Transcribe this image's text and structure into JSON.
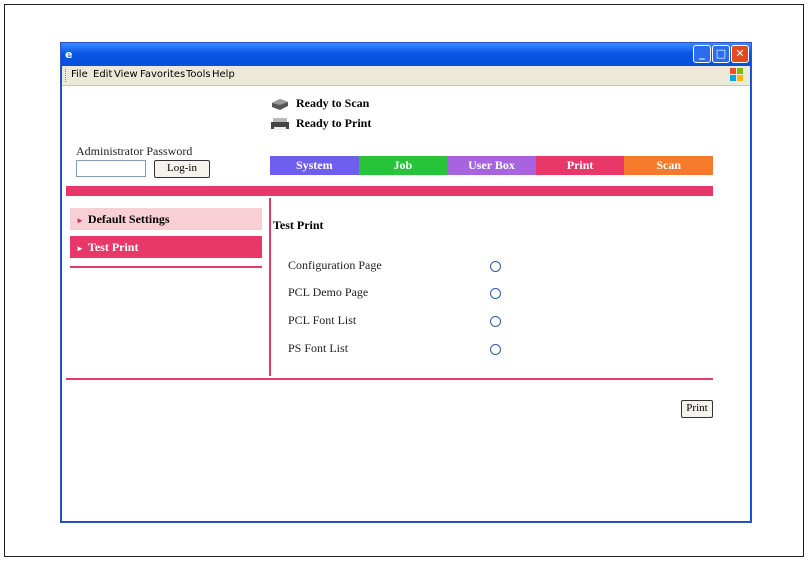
{
  "menu": [
    "File",
    "Edit",
    "View",
    "Favorites",
    "Tools",
    "Help"
  ],
  "status": {
    "scan": "Ready to Scan",
    "print": "Ready to Print"
  },
  "admin": {
    "label": "Administrator Password",
    "login_label": "Log-in"
  },
  "tabs": [
    {
      "label": "System",
      "color": "#6f5df0"
    },
    {
      "label": "Job",
      "color": "#27c43a"
    },
    {
      "label": "User Box",
      "color": "#a863e0"
    },
    {
      "label": "Print",
      "color": "#e8386a"
    },
    {
      "label": "Scan",
      "color": "#f57a2a"
    }
  ],
  "sidebar": {
    "items": [
      {
        "label": "Default Settings"
      },
      {
        "label": "Test Print"
      }
    ]
  },
  "main": {
    "title": "Test Print",
    "options": [
      {
        "label": "Configuration Page"
      },
      {
        "label": "PCL Demo Page"
      },
      {
        "label": "PCL Font List"
      },
      {
        "label": "PS Font List"
      }
    ],
    "print_label": "Print"
  },
  "colors": {
    "accent": "#e8386a",
    "title_bar": "#0a55e4"
  }
}
